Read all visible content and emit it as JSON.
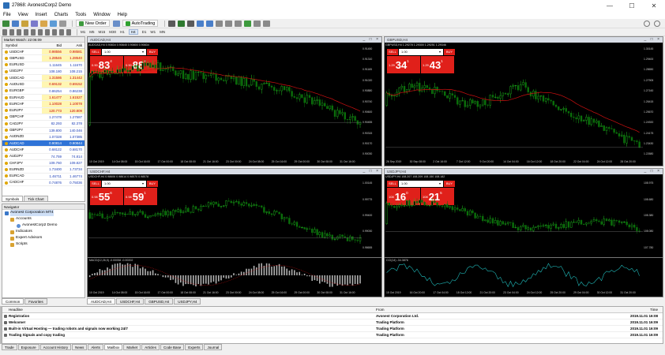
{
  "window": {
    "title": "27868: AvonestCorp2 Demo",
    "min": "—",
    "max": "☐",
    "close": "✕"
  },
  "menu": [
    "File",
    "View",
    "Insert",
    "Charts",
    "Tools",
    "Window",
    "Help"
  ],
  "toolbar": {
    "new_order": "New Order",
    "autotrading": "AutoTrading",
    "timeframes": [
      "M1",
      "M5",
      "M15",
      "M30",
      "H1",
      "H4",
      "D1",
      "W1",
      "MN"
    ],
    "active_timeframe": "H4"
  },
  "market_watch": {
    "title": "Market Watch: 22:06:09",
    "headers": [
      "Symbol",
      "Bid",
      "Ask"
    ],
    "rows": [
      {
        "symbol": "USDCHF",
        "bid": "0.98556",
        "ask": "0.98581"
      },
      {
        "symbol": "GBPUSD",
        "bid": "1.28546",
        "ask": "1.28540"
      },
      {
        "symbol": "EURUSD",
        "bid": "1.11645",
        "ask": "1.11670"
      },
      {
        "symbol": "USDJPY",
        "bid": "108.180",
        "ask": "108.215"
      },
      {
        "symbol": "USDCAD",
        "bid": "1.31586",
        "ask": "1.31442"
      },
      {
        "symbol": "AUDUSD",
        "bid": "0.69132",
        "ask": "0.69152"
      },
      {
        "symbol": "EURGBP",
        "bid": "0.86254",
        "ask": "0.86238"
      },
      {
        "symbol": "EURAUD",
        "bid": "1.61477",
        "ask": "1.61527"
      },
      {
        "symbol": "EURCHF",
        "bid": "1.10028",
        "ask": "1.10078"
      },
      {
        "symbol": "EURJPY",
        "bid": "120.773",
        "ask": "120.809"
      },
      {
        "symbol": "GBPCHF",
        "bid": "1.27478",
        "ask": "1.27587"
      },
      {
        "symbol": "CADJPY",
        "bid": "82.293",
        "ask": "82.378"
      },
      {
        "symbol": "GBPJPY",
        "bid": "139.800",
        "ask": "140.046"
      },
      {
        "symbol": "AUDNZD",
        "bid": "1.07328",
        "ask": "1.07385"
      },
      {
        "symbol": "AUDCAD",
        "bid": "0.90814",
        "ask": "0.90844"
      },
      {
        "symbol": "AUDCHF",
        "bid": "0.68122",
        "ask": "0.68170"
      },
      {
        "symbol": "AUDJPY",
        "bid": "74.759",
        "ask": "74.814"
      },
      {
        "symbol": "CHFJPY",
        "bid": "109.760",
        "ask": "109.827"
      },
      {
        "symbol": "EURNZD",
        "bid": "1.73400",
        "ask": "1.73734"
      },
      {
        "symbol": "EURCAD",
        "bid": "1.46711",
        "ask": "1.46774"
      },
      {
        "symbol": "CADCHF",
        "bid": "0.74876",
        "ask": "0.75036"
      }
    ],
    "tabs": [
      "Symbols",
      "Tick Chart"
    ]
  },
  "navigator": {
    "title": "Navigator",
    "items": [
      "Avonest Corporation MT4",
      "Accounts",
      "AvonestCorp2 Demo",
      "Indicators",
      "Expert Advisors",
      "Scripts"
    ],
    "tabs": [
      "Common",
      "Favorites"
    ]
  },
  "charts": [
    {
      "title": "AUDCAD,H4",
      "header": "AUDCAD,H4  0.90834 0.90845 0.90800 0.90834",
      "lot": "1.00",
      "sell_small": "0.90",
      "sell_big": "83",
      "sell_sup": "4",
      "buy_small": "0.90",
      "buy_big": "88",
      "buy_sup": "4",
      "yticks": [
        "0.91450",
        "0.91310",
        "0.91165",
        "0.91020",
        "0.90880",
        "0.90740",
        "0.90600",
        "0.90455",
        "0.90315",
        "0.90170",
        "0.90030"
      ],
      "xticks": [
        "10 Oct 2019",
        "14 Oct 08:00",
        "15 Oct 16:00",
        "17 Oct 00:00",
        "18 Oct 08:00",
        "21 Oct 16:00",
        "23 Oct 00:00",
        "24 Oct 08:00",
        "25 Oct 16:00",
        "29 Oct 00:00",
        "30 Oct 08:00",
        "31 Oct 16:00"
      ]
    },
    {
      "title": "GBPUSD,H4",
      "header": "GBPUSD,H4  1.29278 1.29300 1.29251 1.29346",
      "lot": "1.00",
      "sell_small": "1.29",
      "sell_big": "34",
      "sell_sup": "1",
      "buy_small": "1.29",
      "buy_big": "43",
      "buy_sup": "1",
      "yticks": [
        "1.30145",
        "1.29400",
        "1.28650",
        "1.27905",
        "1.27160",
        "1.26415",
        "1.25670",
        "1.24920",
        "1.24175",
        "1.23430",
        "1.22680"
      ],
      "xticks": [
        "26 Sep 2019",
        "30 Sep 08:00",
        "2 Oct 16:00",
        "7 Oct 12:00",
        "9 Oct 20:00",
        "14 Oct 04:00",
        "16 Oct 12:00",
        "18 Oct 20:00",
        "22 Oct 04:00",
        "24 Oct 12:00",
        "28 Oct 20:00"
      ]
    },
    {
      "title": "USDCHF,H4",
      "header": "USDCHF,H4  0.98606 0.98614 0.98570 0.98578",
      "lot": "1.00",
      "sell_small": "0.98",
      "sell_big": "55",
      "sell_sup": "6",
      "buy_small": "0.98",
      "buy_big": "59",
      "buy_sup": "1",
      "yticks": [
        "1.00145",
        "0.99775",
        "0.99400",
        "0.99030",
        "0.98655"
      ],
      "sub_header": "MACD(12,26,9) -0.00058 -0.00202",
      "xticks": [
        "10 Oct 2019",
        "14 Oct 08:00",
        "15 Oct 16:00",
        "17 Oct 00:00",
        "18 Oct 08:00",
        "21 Oct 16:00",
        "23 Oct 00:00",
        "24 Oct 08:00",
        "25 Oct 16:00",
        "29 Oct 00:00",
        "30 Oct 08:00",
        "31 Oct 16:00"
      ]
    },
    {
      "title": "USDJPY,H4",
      "header": "USDJPY,H4  108.207 108.209 108.150 108.182",
      "lot": "1.00",
      "sell_small": "108",
      "sell_big": "16",
      "sell_sup": "0",
      "buy_small": "108",
      "buy_big": "21",
      "buy_sup": "5",
      "yticks": [
        "108.975",
        "108.680",
        "108.380",
        "108.080",
        "107.780"
      ],
      "sub_header": "CCI(14) -34.3876",
      "xticks": [
        "15 Oct 2019",
        "16 Oct 20:00",
        "17 Oct 04:00",
        "18 Oct 12:00",
        "21 Oct 20:00",
        "23 Oct 04:00",
        "24 Oct 12:00",
        "25 Oct 20:00",
        "29 Oct 04:00",
        "30 Oct 12:00",
        "31 Oct 20:00"
      ]
    }
  ],
  "chart_tabs": [
    "AUDCAD,H4",
    "USDCHF,H4",
    "GBPUSD,H4",
    "USDJPY,H4"
  ],
  "terminal": {
    "headers": [
      "Headline",
      "From",
      "Time"
    ],
    "rows": [
      {
        "headline": "Registration",
        "from": "Avonest Corporation Ltd.",
        "time": "2019.11.01 16:08"
      },
      {
        "headline": "Welcome!",
        "from": "Trading Platform",
        "time": "2019.11.01 16:09"
      },
      {
        "headline": "Built-in Virtual Hosting — trading robots and signals now working 24/7",
        "from": "Trading Platform",
        "time": "2019.11.01 16:09"
      },
      {
        "headline": "Trading Signals and copy trading",
        "from": "Trading Platform",
        "time": "2019.11.01 16:09"
      }
    ],
    "tabs": [
      "Trade",
      "Exposure",
      "Account History",
      "News",
      "Alerts",
      "Mailbox",
      "Market",
      "Articles",
      "Code Base",
      "Experts",
      "Journal"
    ],
    "active_tab": "Mailbox"
  },
  "colors": {
    "bull": "#1fbf1f",
    "bear": "#0a6e0a",
    "ma": "#d01010",
    "sell": "#e0201a"
  }
}
